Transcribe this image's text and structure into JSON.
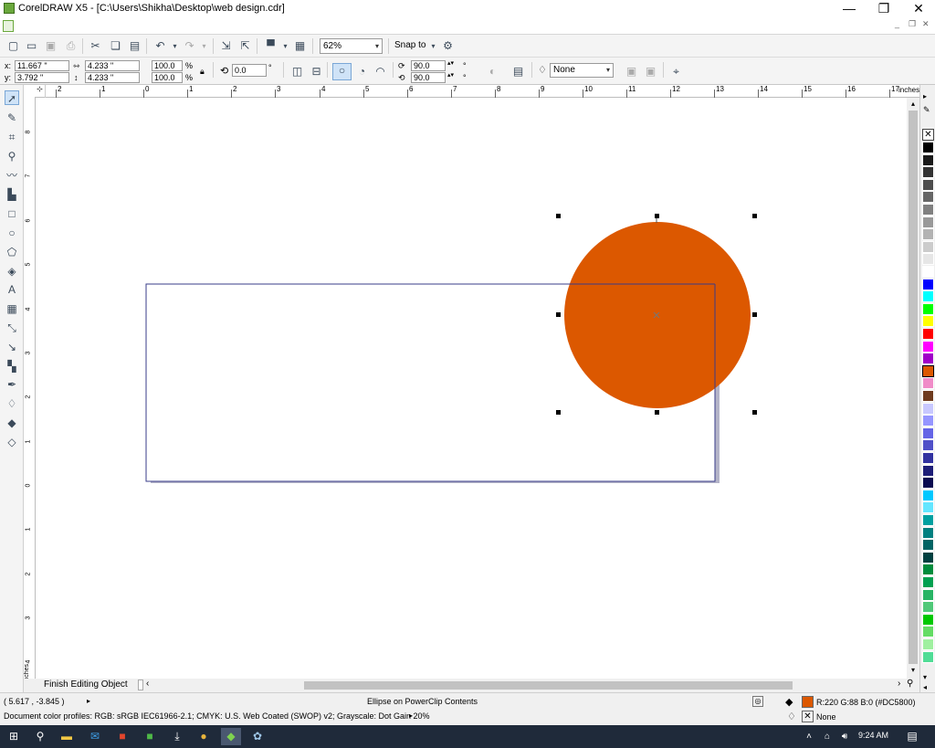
{
  "window": {
    "title": "CorelDRAW X5 - [C:\\Users\\Shikha\\Desktop\\web design.cdr]",
    "minimize": "—",
    "restore": "❐",
    "close": "✕"
  },
  "mdi": {
    "minimize": "_",
    "restore": "❐",
    "close": "✕"
  },
  "toolbar": {
    "zoom_value": "62%",
    "snap_label": "Snap to"
  },
  "property_bar": {
    "x_label": "x:",
    "x_value": "11.667 \"",
    "y_label": "y:",
    "y_value": "3.792 \"",
    "width_value": "4.233 \"",
    "height_value": "4.233 \"",
    "scale_x": "100.0",
    "scale_y": "100.0",
    "percent": "%",
    "rotation_value": "0.0",
    "degree": "°",
    "start_angle": "90.0",
    "end_angle": "90.0",
    "outline_value": "None"
  },
  "rulers": {
    "h_ticks": [
      "2",
      "1",
      "0",
      "1",
      "2",
      "3",
      "4",
      "5",
      "6",
      "7",
      "8",
      "9",
      "10",
      "11",
      "12",
      "13",
      "14",
      "15",
      "16",
      "17"
    ],
    "h_unit": "inches",
    "v_ticks": [
      "8",
      "7",
      "6",
      "5",
      "4",
      "3",
      "2",
      "1",
      "0",
      "1",
      "2",
      "3",
      "4"
    ],
    "v_unit": "inches"
  },
  "document": {
    "tab_label": "Finish Editing Object",
    "ellipse_color": "#DC5800",
    "page_border_color": "#3a3d8a"
  },
  "status": {
    "cursor_coords": "( 5.617 , -3.845 )",
    "object_info": "Ellipse on PowerClip Contents",
    "color_profiles": "Document color profiles: RGB: sRGB IEC61966-2.1; CMYK: U.S. Web Coated (SWOP) v2; Grayscale: Dot Gain 20%",
    "fill_info": "R:220 G:88 B:0 (#DC5800)",
    "outline_info": "None"
  },
  "palette": {
    "colors": [
      "#000000",
      "#1a1a1a",
      "#333333",
      "#4d4d4d",
      "#666666",
      "#808080",
      "#999999",
      "#b3b3b3",
      "#cccccc",
      "#e6e6e6",
      "#ffffff",
      "#0000ff",
      "#00ffff",
      "#00ff00",
      "#ffff00",
      "#ff0000",
      "#ff00ff",
      "#a000c8",
      "#DC5800",
      "#f08cc8",
      "#6e3a1e",
      "#c8c8ff",
      "#9696ff",
      "#6464e6",
      "#5050c8",
      "#3232a0",
      "#1e1e78",
      "#0a0a50",
      "#00c8ff",
      "#64e6ff",
      "#00a0a0",
      "#008080",
      "#006464",
      "#004040",
      "#008c3c",
      "#00a050",
      "#28b464",
      "#50c878",
      "#00c800",
      "#64dc64",
      "#a0f0a0",
      "#50dc96"
    ]
  },
  "taskbar": {
    "time": "9:24 AM"
  }
}
